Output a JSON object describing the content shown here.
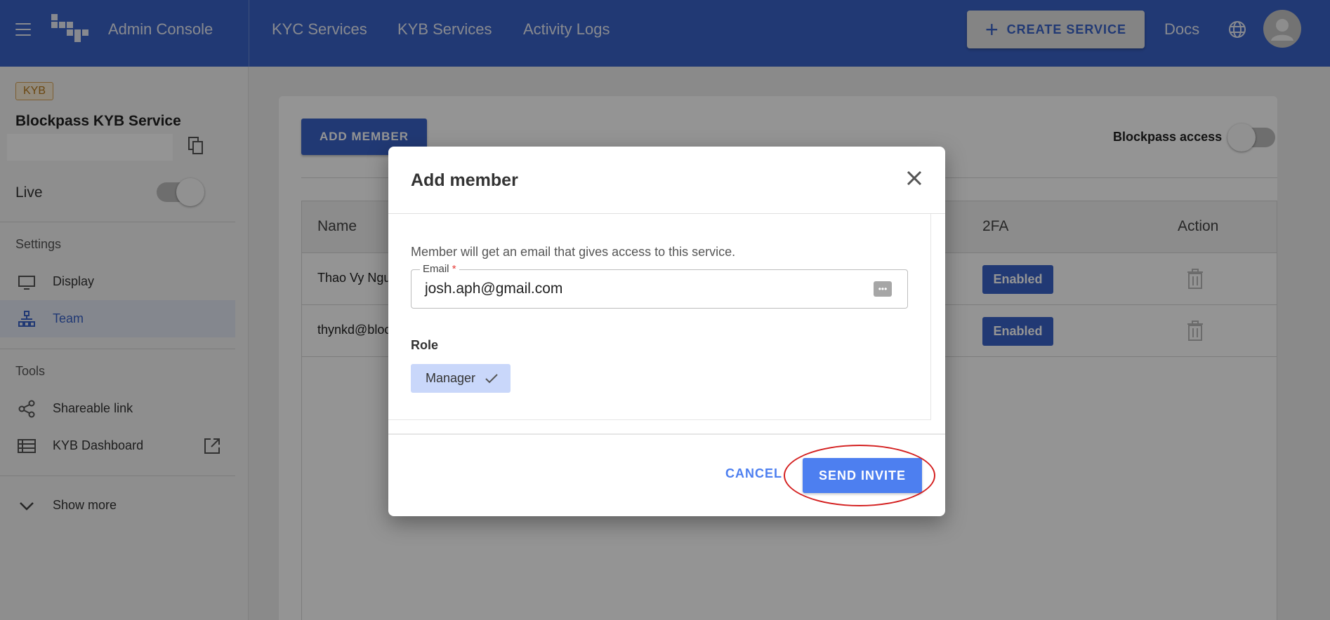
{
  "header": {
    "app_title": "Admin Console",
    "nav": [
      "KYC Services",
      "KYB Services",
      "Activity Logs"
    ],
    "create_label": "CREATE SERVICE",
    "docs_label": "Docs"
  },
  "sidebar": {
    "badge": "KYB",
    "service_name": "Blockpass KYB Service",
    "live_label": "Live",
    "settings_heading": "Settings",
    "settings_items": [
      "Display",
      "Team"
    ],
    "tools_heading": "Tools",
    "tools_items": [
      "Shareable link",
      "KYB Dashboard"
    ],
    "show_more": "Show more"
  },
  "main": {
    "add_member_label": "ADD MEMBER",
    "blockpass_access_label": "Blockpass access",
    "table": {
      "headers": [
        "Name",
        "2FA",
        "Action"
      ],
      "rows": [
        {
          "name": "Thao Vy Ngu",
          "twofa": "Enabled"
        },
        {
          "name": "thynkd@bloc",
          "twofa": "Enabled"
        }
      ]
    }
  },
  "modal": {
    "title": "Add member",
    "helper": "Member will get an email that gives access to this service.",
    "email_label": "Email",
    "email_required": "*",
    "email_value": "josh.aph@gmail.com",
    "role_label": "Role",
    "role_value": "Manager",
    "cancel_label": "CANCEL",
    "send_label": "SEND INVITE"
  },
  "colors": {
    "primary": "#3a63c9",
    "send_button": "#4d7ff0",
    "highlight": "#d42020"
  }
}
